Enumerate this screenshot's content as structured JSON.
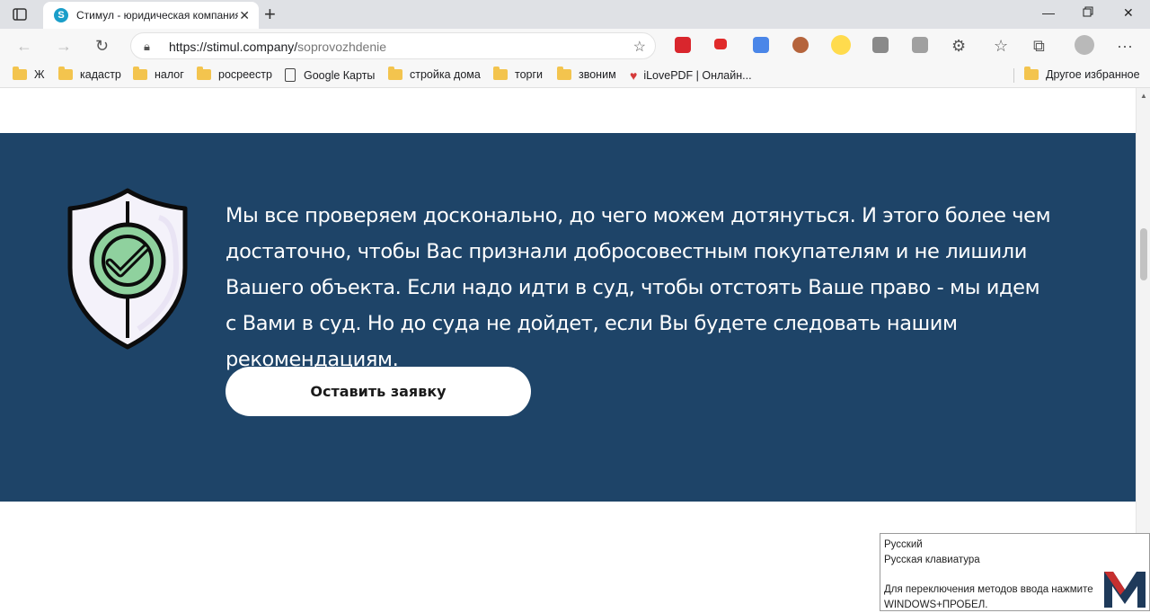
{
  "browser": {
    "tab_title": "Стимул - юридическая компания",
    "tab_favicon_letter": "S",
    "url_host": "https://stimul.company/",
    "url_path": "soprovozhdenie"
  },
  "bookmarks": {
    "items": [
      {
        "label": "Ж",
        "type": "folder"
      },
      {
        "label": "кадастр",
        "type": "folder"
      },
      {
        "label": "налог",
        "type": "folder"
      },
      {
        "label": "росреестр",
        "type": "folder"
      },
      {
        "label": "Google Карты",
        "type": "page"
      },
      {
        "label": "стройка дома",
        "type": "folder"
      },
      {
        "label": "торги",
        "type": "folder"
      },
      {
        "label": "звоним",
        "type": "folder"
      },
      {
        "label": "iLovePDF | Онлайн...",
        "type": "heart"
      }
    ],
    "other": "Другое избранное"
  },
  "hero": {
    "paragraph": "Мы все проверяем досконально, до чего можем дотянуться. И этого более чем достаточно, чтобы Вас признали добросовестным покупателям и не лишили Вашего объекта. Если надо идти в суд, чтобы отстоять Ваше право - мы идем с Вами в суд. Но до суда не дойдет, если Вы будете следовать нашим рекомендациям.",
    "cta_label": "Оставить заявку",
    "colors": {
      "background": "#1e4468",
      "shield_check": "#8fd19e"
    }
  },
  "ime_popup": {
    "line1": "Русский",
    "line2": "Русская клавиатура",
    "line3": "Для переключения методов ввода нажмите",
    "line4": "WINDOWS+ПРОБЕЛ."
  }
}
